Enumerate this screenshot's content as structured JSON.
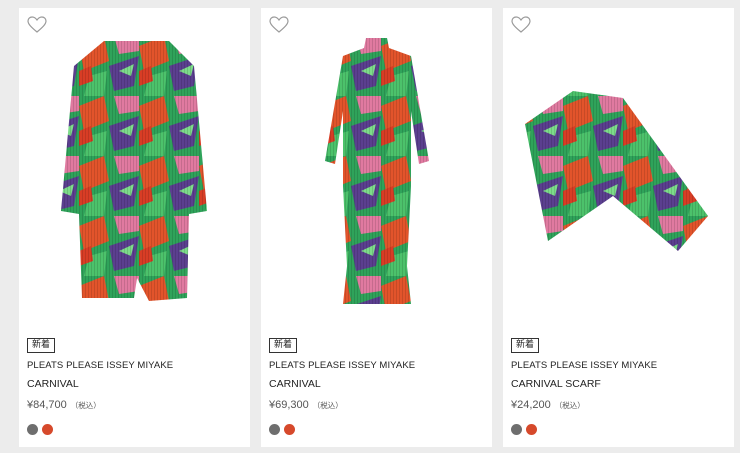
{
  "products": [
    {
      "badge": "新着",
      "brand": "PLEATS PLEASE ISSEY MIYAKE",
      "name": "CARNIVAL",
      "price": "¥84,700",
      "tax": "（税込）",
      "image_icon": "long-coat",
      "swatches": [
        {
          "color": "#6e6e6e"
        },
        {
          "color": "#d6492b"
        }
      ]
    },
    {
      "badge": "新着",
      "brand": "PLEATS PLEASE ISSEY MIYAKE",
      "name": "CARNIVAL",
      "price": "¥69,300",
      "tax": "（税込）",
      "image_icon": "dress",
      "swatches": [
        {
          "color": "#6e6e6e"
        },
        {
          "color": "#d6492b"
        }
      ]
    },
    {
      "badge": "新着",
      "brand": "PLEATS PLEASE ISSEY MIYAKE",
      "name": "CARNIVAL SCARF",
      "price": "¥24,200",
      "tax": "（税込）",
      "image_icon": "scarf",
      "swatches": [
        {
          "color": "#6e6e6e"
        },
        {
          "color": "#d6492b"
        }
      ]
    }
  ]
}
